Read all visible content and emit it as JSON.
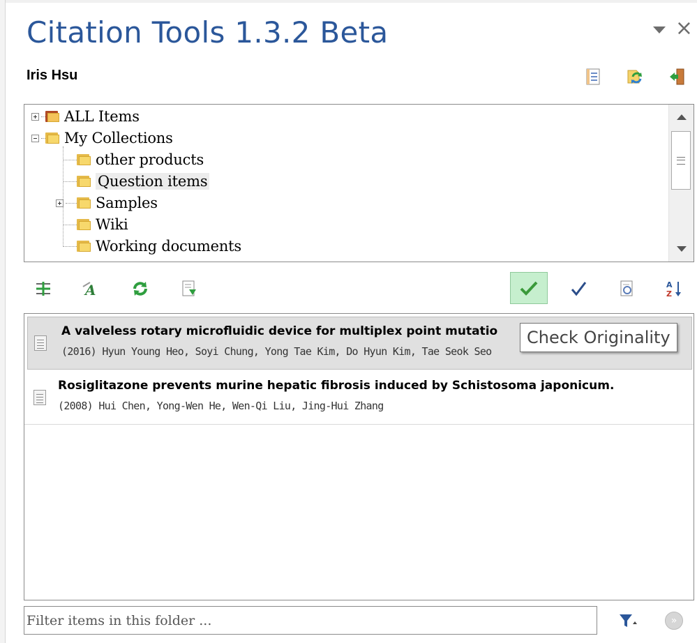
{
  "panel": {
    "title": "Citation Tools 1.3.2 Beta",
    "user": "Iris Hsu"
  },
  "header_icons": [
    "document-list-icon",
    "sync-icon",
    "logout-door-icon"
  ],
  "tree": {
    "items": [
      {
        "label": "ALL Items",
        "expander": "plus"
      },
      {
        "label": "My Collections",
        "expander": "minus"
      },
      {
        "label": "other products"
      },
      {
        "label": "Question items",
        "selected": true
      },
      {
        "label": "Samples",
        "expander": "plus"
      },
      {
        "label": "Wiki"
      },
      {
        "label": "Working documents"
      }
    ]
  },
  "toolbar": {
    "left_icons": [
      "insert-citation-icon",
      "format-text-icon",
      "refresh-icon",
      "export-document-icon"
    ],
    "right_icons": [
      "check-originality-icon",
      "check-icon",
      "document-preview-icon",
      "sort-az-icon"
    ]
  },
  "tooltip": "Check Originality",
  "list": {
    "items": [
      {
        "title": "A valveless rotary microfluidic device for multiplex point mutatio",
        "meta": "(2016) Hyun Young Heo, Soyi Chung, Yong Tae Kim, Do Hyun Kim, Tae Seok Seo",
        "selected": true
      },
      {
        "title": "Rosiglitazone prevents murine hepatic fibrosis induced by Schistosoma japonicum.",
        "meta": "(2008) Hui Chen, Yong-Wen He, Wen-Qi Liu, Jing-Hui Zhang",
        "selected": false
      }
    ]
  },
  "filter": {
    "placeholder": "Filter items in this folder ...",
    "value": ""
  },
  "colors": {
    "title": "#2b579a",
    "check_active_bg": "#c6efce",
    "selected_row": "#e0e0e0"
  }
}
